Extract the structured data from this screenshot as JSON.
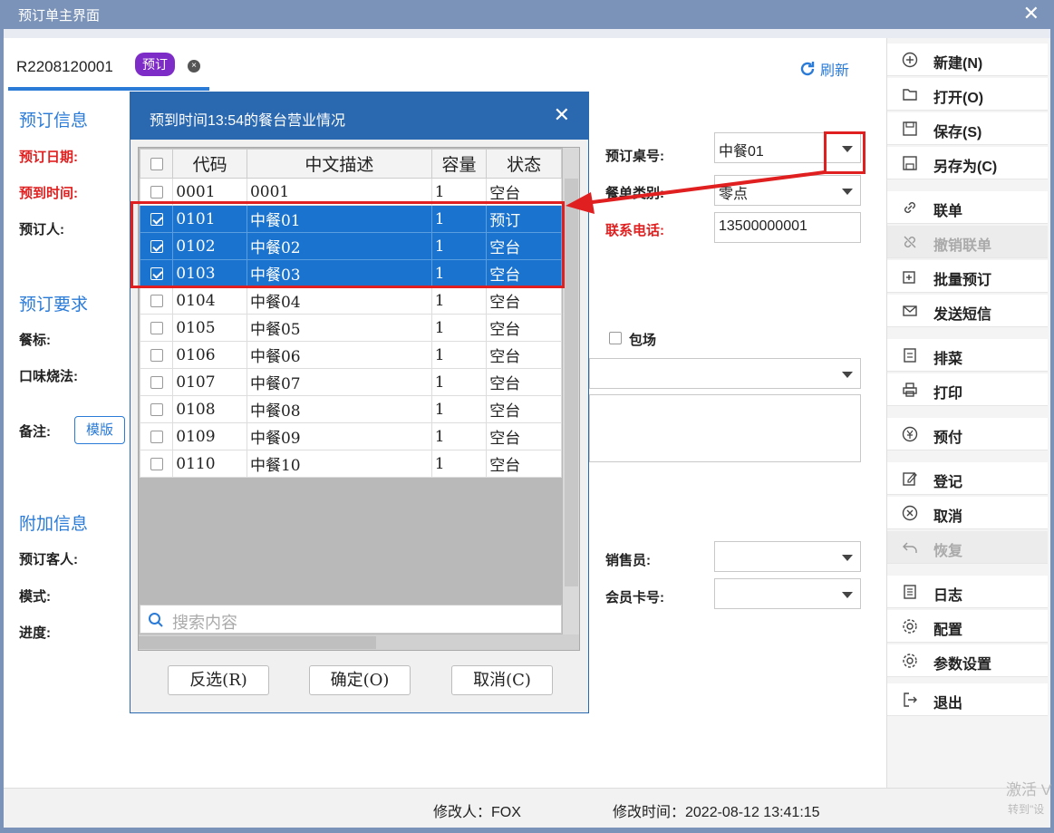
{
  "window": {
    "title": "预订单主界面",
    "close": "✕"
  },
  "tab": {
    "id": "R2208120001",
    "badge": "预订",
    "close": "×"
  },
  "refresh_label": "刷新",
  "sections": {
    "info": "预订信息",
    "req": "预订要求",
    "extra": "附加信息"
  },
  "labels": {
    "date": "预订日期:",
    "arrive": "预到时间:",
    "person": "预订人:",
    "table_no": "预订桌号:",
    "category": "餐单类别:",
    "phone": "联系电话:",
    "standard": "餐标:",
    "taste": "口味烧法:",
    "note": "备注:",
    "guest": "预订客人:",
    "mode": "模式:",
    "progress": "进度:",
    "sales": "销售员:",
    "member": "会员卡号:",
    "whole": "包场"
  },
  "values": {
    "table_no": "中餐01",
    "category": "零点",
    "phone": "13500000001"
  },
  "template_btn": "模版",
  "sidebar": [
    {
      "label": "新建(N)",
      "icon": "plus-circle-icon"
    },
    {
      "label": "打开(O)",
      "icon": "folder-open-icon"
    },
    {
      "label": "保存(S)",
      "icon": "save-icon"
    },
    {
      "label": "另存为(C)",
      "icon": "save-as-icon"
    },
    {
      "label": "联单",
      "icon": "link-icon"
    },
    {
      "label": "撤销联单",
      "icon": "unlink-icon",
      "disabled": true
    },
    {
      "label": "批量预订",
      "icon": "batch-add-icon"
    },
    {
      "label": "发送短信",
      "icon": "mail-icon"
    },
    {
      "label": "排菜",
      "icon": "dish-list-icon"
    },
    {
      "label": "打印",
      "icon": "printer-icon"
    },
    {
      "label": "预付",
      "icon": "prepay-icon"
    },
    {
      "label": "登记",
      "icon": "edit-icon"
    },
    {
      "label": "取消",
      "icon": "cancel-circle-icon"
    },
    {
      "label": "恢复",
      "icon": "undo-icon",
      "disabled": true
    },
    {
      "label": "日志",
      "icon": "log-icon"
    },
    {
      "label": "配置",
      "icon": "gear-icon"
    },
    {
      "label": "参数设置",
      "icon": "settings-icon"
    },
    {
      "label": "退出",
      "icon": "exit-icon"
    }
  ],
  "status": {
    "modifier": "修改人：FOX",
    "time": "修改时间：2022-08-12 13:41:15"
  },
  "watermark": {
    "line1": "激活 V",
    "line2": "转到\"设"
  },
  "dialog": {
    "title": "预到时间13:54的餐台营业情况",
    "close": "✕",
    "columns": [
      "代码",
      "中文描述",
      "容量",
      "状态"
    ],
    "rows": [
      {
        "code": "0001",
        "desc": "0001",
        "cap": "1",
        "status": "空台",
        "checked": false
      },
      {
        "code": "0101",
        "desc": "中餐01",
        "cap": "1",
        "status": "预订",
        "checked": true
      },
      {
        "code": "0102",
        "desc": "中餐02",
        "cap": "1",
        "status": "空台",
        "checked": true
      },
      {
        "code": "0103",
        "desc": "中餐03",
        "cap": "1",
        "status": "空台",
        "checked": true
      },
      {
        "code": "0104",
        "desc": "中餐04",
        "cap": "1",
        "status": "空台",
        "checked": false
      },
      {
        "code": "0105",
        "desc": "中餐05",
        "cap": "1",
        "status": "空台",
        "checked": false
      },
      {
        "code": "0106",
        "desc": "中餐06",
        "cap": "1",
        "status": "空台",
        "checked": false
      },
      {
        "code": "0107",
        "desc": "中餐07",
        "cap": "1",
        "status": "空台",
        "checked": false
      },
      {
        "code": "0108",
        "desc": "中餐08",
        "cap": "1",
        "status": "空台",
        "checked": false
      },
      {
        "code": "0109",
        "desc": "中餐09",
        "cap": "1",
        "status": "空台",
        "checked": false
      },
      {
        "code": "0110",
        "desc": "中餐10",
        "cap": "1",
        "status": "空台",
        "checked": false
      }
    ],
    "search_placeholder": "搜索内容",
    "buttons": {
      "invert": "反选(R)",
      "ok": "确定(O)",
      "cancel": "取消(C)"
    }
  },
  "colors": {
    "accent": "#2a7bd8",
    "selected": "#1a73cf",
    "highlight": "#e02020",
    "badge": "#7e2cc7"
  }
}
